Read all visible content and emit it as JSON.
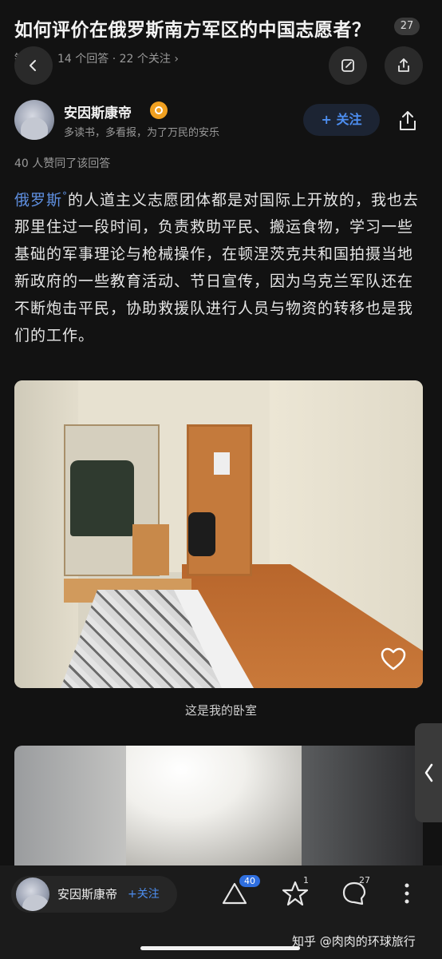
{
  "question": {
    "title": "如何评价在俄罗斯南方军区的中国志愿者？",
    "badge": "27",
    "meta_prefix": "针",
    "meta": "14 个回答 · 22 个关注 ›"
  },
  "author": {
    "name": "安因斯康帝",
    "bio": "多读书，多看报，为了万民的安乐",
    "follow_label": "+ 关注"
  },
  "likes_line": "40 人赞同了该回答",
  "answer": {
    "link_text": "俄罗斯",
    "text": "的人道主义志愿团体都是对国际上开放的，我也去那里住过一段时间，负责救助平民、搬运食物，学习一些基础的军事理论与枪械操作，在顿涅茨克共和国拍摄当地新政府的一些教育活动、节日宣传，因为乌克兰军队还在不断炮击平民，协助救援队进行人员与物资的转移也是我们的工作。"
  },
  "photo_caption": "这是我的卧室",
  "bottom_bar": {
    "author_name": "安因斯康帝",
    "follow_label": "+关注",
    "upvote_count": "40",
    "favorite_count": "1",
    "comment_count": "27"
  },
  "watermark": "知乎 @肉肉的环球旅行",
  "colors": {
    "background": "#121212",
    "link_blue": "#5e8fe0",
    "follow_blue": "#4d8ef0",
    "verify_orange": "#f0a020"
  }
}
